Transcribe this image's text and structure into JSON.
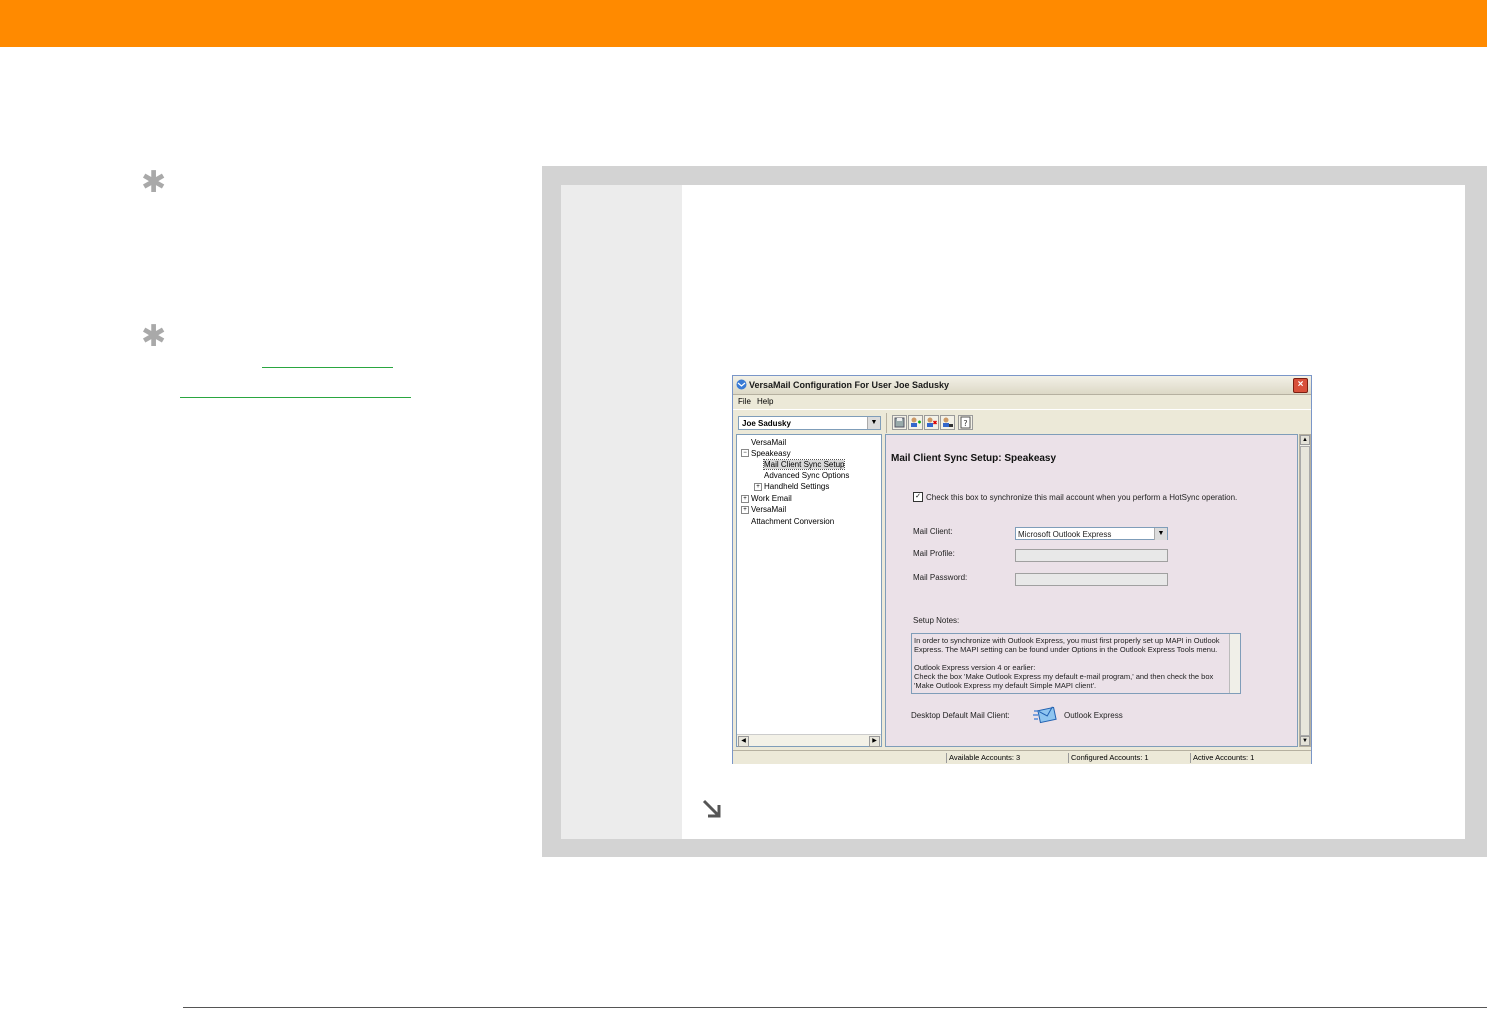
{
  "window": {
    "title": "VersaMail Configuration For User Joe Sadusky",
    "menu": [
      "File",
      "Help"
    ],
    "user_select": "Joe Sadusky"
  },
  "tree": {
    "items": [
      {
        "label": "VersaMail"
      },
      {
        "label": "Speakeasy"
      },
      {
        "label": "Mail Client Sync Setup",
        "selected": true
      },
      {
        "label": "Advanced Sync Options"
      },
      {
        "label": "Handheld Settings"
      },
      {
        "label": "Work Email"
      },
      {
        "label": "VersaMail"
      },
      {
        "label": "Attachment Conversion"
      }
    ]
  },
  "content": {
    "heading": "Mail Client Sync Setup: Speakeasy",
    "checkbox_label": "Check this box to synchronize this mail account when you perform a HotSync operation.",
    "checkbox_checked": true,
    "mail_client_label": "Mail Client:",
    "mail_client_value": "Microsoft Outlook Express",
    "mail_profile_label": "Mail Profile:",
    "mail_password_label": "Mail Password:",
    "setup_notes_label": "Setup Notes:",
    "notes_lines": [
      "In order to synchronize with Outlook Express, you must first properly set up MAPI in Outlook",
      "Express.  The MAPI setting can be found under Options in the Outlook Express Tools menu.",
      "",
      "Outlook Express version 4 or earlier:",
      "Check the box 'Make Outlook Express my default e-mail program,' and then check the box",
      "'Make Outlook Express my default Simple MAPI client'."
    ],
    "desktop_default_label": "Desktop Default Mail Client:",
    "desktop_default_value": "Outlook Express"
  },
  "status": {
    "available": "Available Accounts: 3",
    "configured": "Configured Accounts: 1",
    "active": "Active Accounts: 1"
  },
  "colors": {
    "accent": "#ff8a00",
    "panel": "#d3d3d3",
    "tip_link": "#2aa640"
  }
}
